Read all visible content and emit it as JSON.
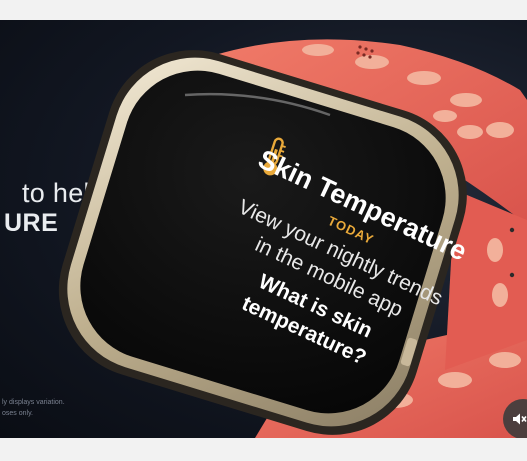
{
  "background": {
    "line1": "to help",
    "line2": "URE",
    "disclaimer_line1": "ly displays variation.",
    "disclaimer_line2": "oses only."
  },
  "screen": {
    "title": "Skin Temperature",
    "today_label": "TODAY",
    "body_line1": "View your nightly trends",
    "body_line2": "in the mobile app",
    "question_line1": "What is skin",
    "question_line2": "temperature?",
    "icon": "thermometer-icon",
    "accent_color": "#e9a93a"
  },
  "controls": {
    "mute_icon": "mute-icon"
  },
  "colors": {
    "band": "#e8645a",
    "band_light": "#f2a28a",
    "background": "#121722",
    "bezel": "#d8cbb0"
  }
}
